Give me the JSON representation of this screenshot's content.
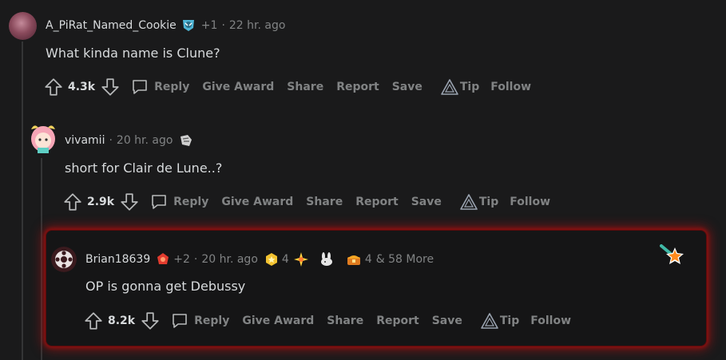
{
  "comments": [
    {
      "username": "A_PiRat_Named_Cookie",
      "plus": "+1",
      "time": "22 hr. ago",
      "body": "What kinda name is Clune?",
      "score": "4.3k"
    },
    {
      "username": "vivamii",
      "time": "20 hr. ago",
      "body": "short for Clair de Lune..?",
      "score": "2.9k"
    },
    {
      "username": "Brian18639",
      "plus": "+2",
      "time": "20 hr. ago",
      "award_count_1": "4",
      "award_count_2": "4",
      "more_awards": "& 58 More",
      "body": "OP is gonna get Debussy",
      "score": "8.2k"
    }
  ],
  "actions": {
    "reply": "Reply",
    "give_award": "Give Award",
    "share": "Share",
    "report": "Report",
    "save": "Save",
    "tip": "Tip",
    "follow": "Follow"
  },
  "colors": {
    "background": "#1a1a1b",
    "text": "#d7dadc",
    "muted": "#818384",
    "highlight_glow": "#c81414",
    "thread_line": "#343536"
  },
  "icons": [
    "upvote-icon",
    "downvote-icon",
    "reply-icon",
    "tip-icon",
    "star-award-icon"
  ]
}
